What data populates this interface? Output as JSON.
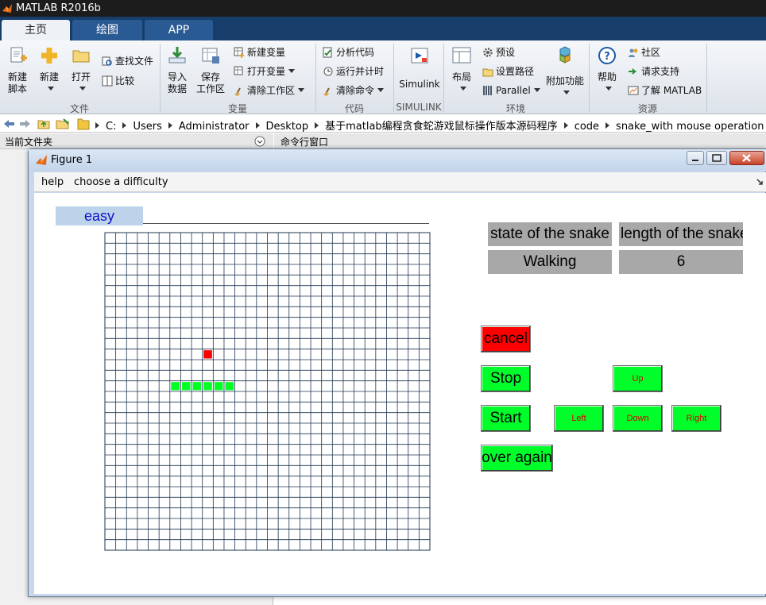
{
  "app": {
    "title": "MATLAB R2016b"
  },
  "tabs": [
    {
      "label": "主页",
      "active": true
    },
    {
      "label": "绘图",
      "active": false
    },
    {
      "label": "APP",
      "active": false
    }
  ],
  "ribbon": {
    "file": {
      "group_label": "文件",
      "new_script": [
        "新建",
        "脚本"
      ],
      "new": "新建",
      "open": "打开",
      "find_files": "查找文件",
      "compare": "比较"
    },
    "variable": {
      "group_label": "变量",
      "import": [
        "导入",
        "数据"
      ],
      "save_workspace": [
        "保存",
        "工作区"
      ],
      "new_variable": "新建变量",
      "open_variable": "打开变量",
      "clear_workspace": "清除工作区"
    },
    "code": {
      "group_label": "代码",
      "analyze_code": "分析代码",
      "run_and_time": "运行并计时",
      "clear_commands": "清除命令"
    },
    "simulink": {
      "group_label": "SIMULINK",
      "simulink": "Simulink"
    },
    "environment": {
      "group_label": "环境",
      "layout": "布局",
      "preferences": "预设",
      "set_path": "设置路径",
      "parallel": "Parallel",
      "add_ons": "附加功能"
    },
    "resources": {
      "group_label": "资源",
      "help": "帮助",
      "community": "社区",
      "request_support": "请求支持",
      "learn_matlab": "了解 MATLAB"
    }
  },
  "address": {
    "path": [
      "C:",
      "Users",
      "Administrator",
      "Desktop",
      "基于matlab编程贪食蛇游戏鼠标操作版本源码程序",
      "code",
      "snake_with mouse operation"
    ]
  },
  "panels": {
    "current_folder": "当前文件夹",
    "command_window": "命令行窗口"
  },
  "figure": {
    "title": "Figure 1",
    "menu": [
      "help",
      "choose a difficulty"
    ],
    "difficulty": "easy",
    "state_header": "state of the snake",
    "length_header": "length of the snake",
    "state_value": "Walking",
    "length_value": "6",
    "buttons": {
      "cancel": "cancel",
      "stop": "Stop",
      "start": "Start",
      "over_again": "over again",
      "up": "Up",
      "left": "Left",
      "down": "Down",
      "right": "Right"
    }
  },
  "game": {
    "grid_cols": 30,
    "grid_rows": 30,
    "snake_cells": [
      [
        6,
        14
      ],
      [
        7,
        14
      ],
      [
        8,
        14
      ],
      [
        9,
        14
      ],
      [
        10,
        14
      ],
      [
        11,
        14
      ]
    ],
    "food_cell": [
      9,
      11
    ],
    "colors": {
      "snake": "#00ff22",
      "food": "#ff0000",
      "grid": "#1f3550",
      "button": "#00ff2a",
      "cancel": "#ff0000"
    }
  }
}
